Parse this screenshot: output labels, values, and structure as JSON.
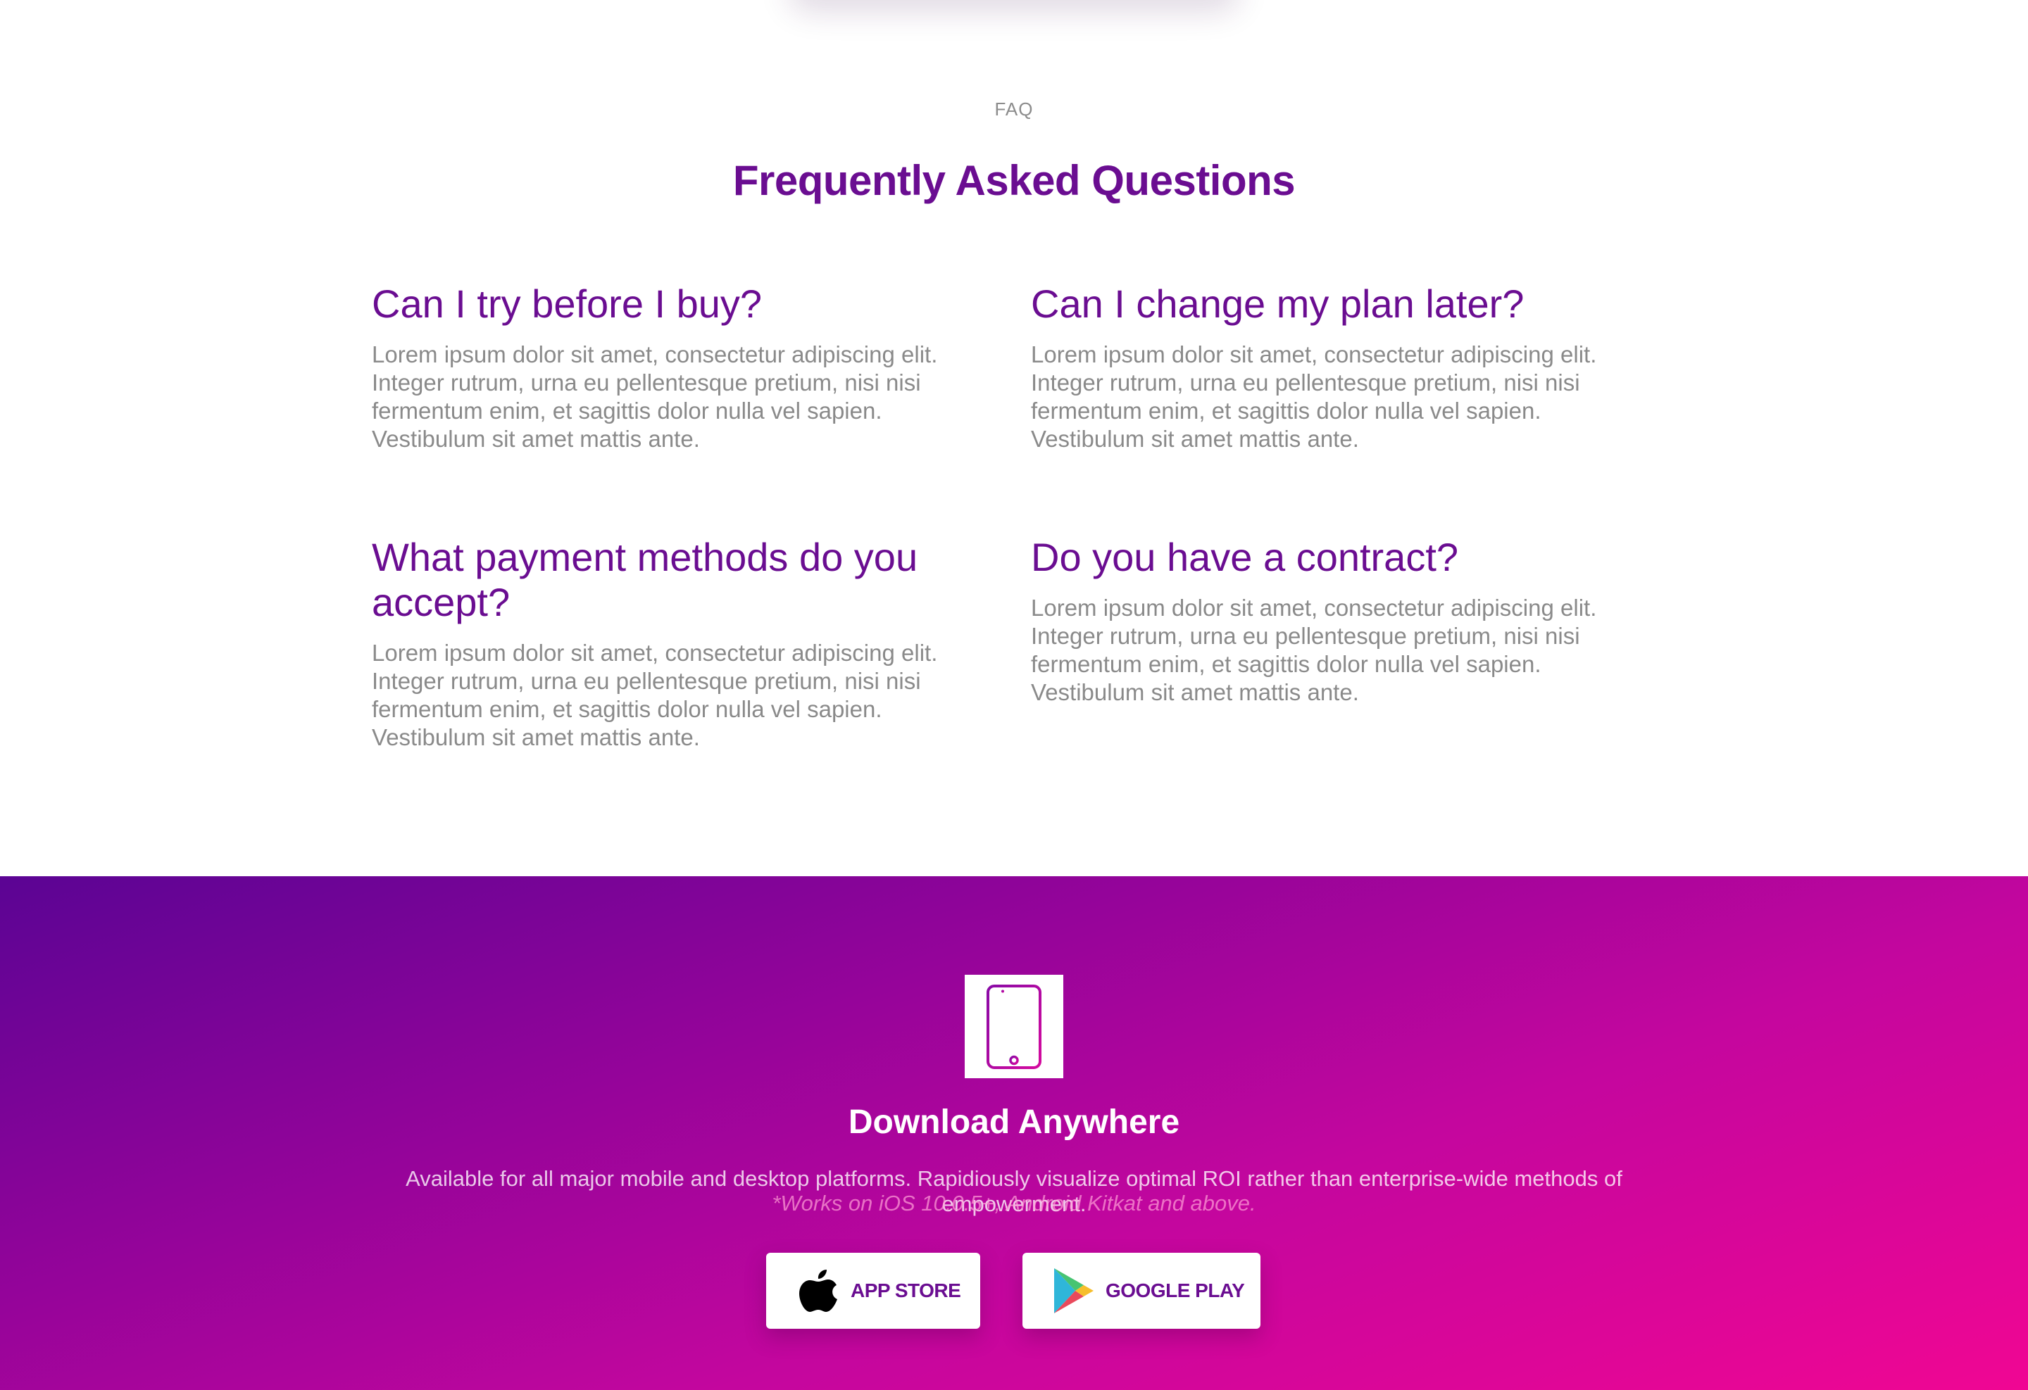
{
  "faq": {
    "eyebrow": "FAQ",
    "heading": "Frequently Asked Questions",
    "items": [
      {
        "question": "Can I try before I buy?",
        "answer": "Lorem ipsum dolor sit amet, consectetur adipiscing elit. Integer rutrum, urna eu pellentesque pretium, nisi nisi fermentum enim, et sagittis dolor nulla vel sapien. Vestibulum sit amet mattis ante."
      },
      {
        "question": "Can I change my plan later?",
        "answer": "Lorem ipsum dolor sit amet, consectetur adipiscing elit. Integer rutrum, urna eu pellentesque pretium, nisi nisi fermentum enim, et sagittis dolor nulla vel sapien. Vestibulum sit amet mattis ante."
      },
      {
        "question": "What payment methods do you accept?",
        "answer": "Lorem ipsum dolor sit amet, consectetur adipiscing elit. Integer rutrum, urna eu pellentesque pretium, nisi nisi fermentum enim, et sagittis dolor nulla vel sapien. Vestibulum sit amet mattis ante."
      },
      {
        "question": "Do you have a contract?",
        "answer": "Lorem ipsum dolor sit amet, consectetur adipiscing elit. Integer rutrum, urna eu pellentesque pretium, nisi nisi fermentum enim, et sagittis dolor nulla vel sapien. Vestibulum sit amet mattis ante."
      }
    ]
  },
  "download": {
    "icon": "mobile-phone-icon",
    "title": "Download Anywhere",
    "description": "Available for all major mobile and desktop platforms. Rapidiously visualize optimal ROI rather than enterprise-wide methods of empowerment.",
    "app_store": {
      "icon": "apple-icon",
      "label": "APP STORE"
    },
    "google_play": {
      "icon": "google-play-icon",
      "label": "GOOGLE PLAY"
    },
    "note": "*Works on iOS 10.0.5+, Android Kitkat and above."
  },
  "colors": {
    "accent_purple": "#6a0d91",
    "gradient_start": "#5b0494",
    "gradient_end": "#f00693",
    "muted_text": "#8a8a8a"
  }
}
